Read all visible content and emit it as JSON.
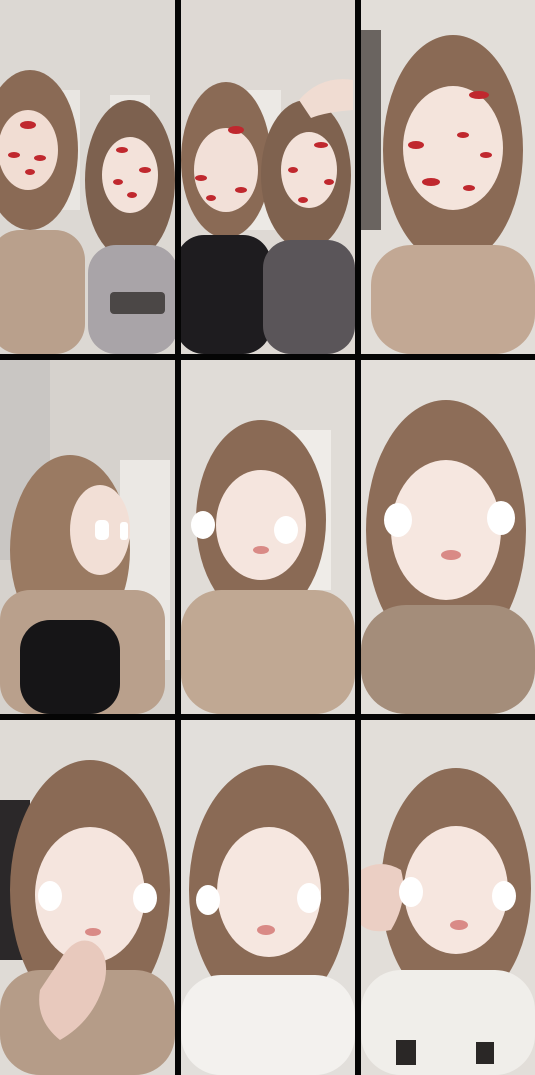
{
  "grid": {
    "rows": 3,
    "columns": 3,
    "tiles": [
      {
        "id": 1,
        "scene": "two-people-kiss-stickers"
      },
      {
        "id": 2,
        "scene": "two-people-kiss-stickers-hand"
      },
      {
        "id": 3,
        "scene": "single-person-kiss-stickers"
      },
      {
        "id": 4,
        "scene": "profile-bear-stickers"
      },
      {
        "id": 5,
        "scene": "front-bear-stickers"
      },
      {
        "id": 6,
        "scene": "closeup-bear-stickers"
      },
      {
        "id": 7,
        "scene": "thumb-bear-stickers"
      },
      {
        "id": 8,
        "scene": "white-shirt-bear-stickers"
      },
      {
        "id": 9,
        "scene": "hand-face-bear-stickers"
      }
    ]
  },
  "colors": {
    "divider": "#050505",
    "wall": "#dcd8d3",
    "skin": "#f3e2da",
    "hair": "#8a6a55",
    "sweater": "#b9a08c",
    "dark_clothing": "#1e1c1f",
    "kiss_mark": "#c0282e",
    "sticker": "#ffffff"
  }
}
